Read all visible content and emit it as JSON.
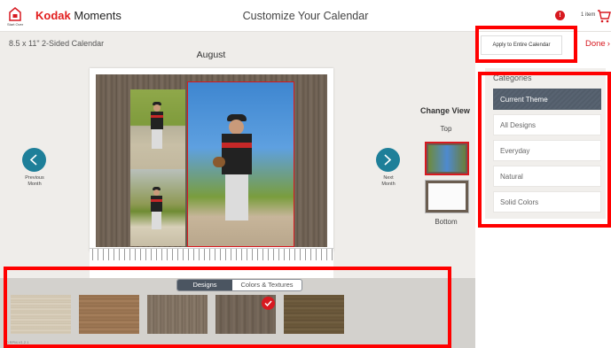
{
  "header": {
    "home_label": "Start Over",
    "brand_kodak": "Kodak",
    "brand_moments": "Moments",
    "page_title": "Customize Your Calendar",
    "alert_badge": "!",
    "cart_count": "1 item"
  },
  "editor": {
    "calendar_size": "8.5 x 11\" 2-Sided Calendar",
    "month": "August",
    "prev_label_1": "Previous",
    "prev_label_2": "Month",
    "next_label_1": "Next",
    "next_label_2": "Month"
  },
  "view": {
    "title": "Change View",
    "top_label": "Top",
    "bottom_label": "Bottom"
  },
  "panel": {
    "apply_button": "Apply to Entire Calendar",
    "done_label": "Done",
    "categories_title": "Categories",
    "categories": [
      "Current Theme",
      "All Designs",
      "Everyday",
      "Natural",
      "Solid Colors"
    ],
    "active_category": "Current Theme"
  },
  "tray": {
    "tabs": [
      "Designs",
      "Colors & Textures"
    ],
    "active_tab": "Designs",
    "swatch_count": 5,
    "selected_swatch": 4,
    "version": "1.0 RPM-V1.2.1"
  },
  "colors": {
    "accent_red": "#d71920",
    "nav_teal": "#1e7f99",
    "active_category_bg": "#525d6a",
    "highlight": "#ff0000"
  }
}
